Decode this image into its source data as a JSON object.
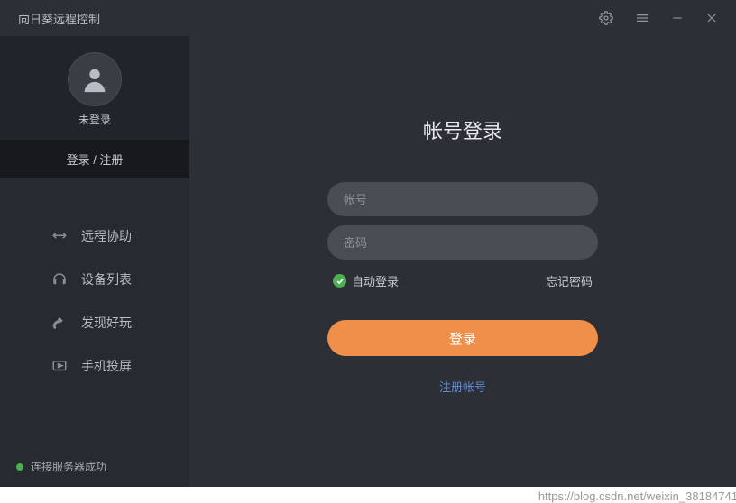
{
  "titlebar": {
    "title": "向日葵远程控制"
  },
  "profile": {
    "avatar_label": "未登录",
    "login_register": "登录 / 注册"
  },
  "nav": {
    "items": [
      {
        "label": "远程协助"
      },
      {
        "label": "设备列表"
      },
      {
        "label": "发现好玩"
      },
      {
        "label": "手机投屏"
      }
    ]
  },
  "status": {
    "text": "连接服务器成功"
  },
  "login": {
    "title": "帐号登录",
    "account_placeholder": "帐号",
    "password_placeholder": "密码",
    "auto_login": "自动登录",
    "forgot": "忘记密码",
    "submit": "登录",
    "register": "注册帐号"
  },
  "watermark": "https://blog.csdn.net/weixin_38184741"
}
